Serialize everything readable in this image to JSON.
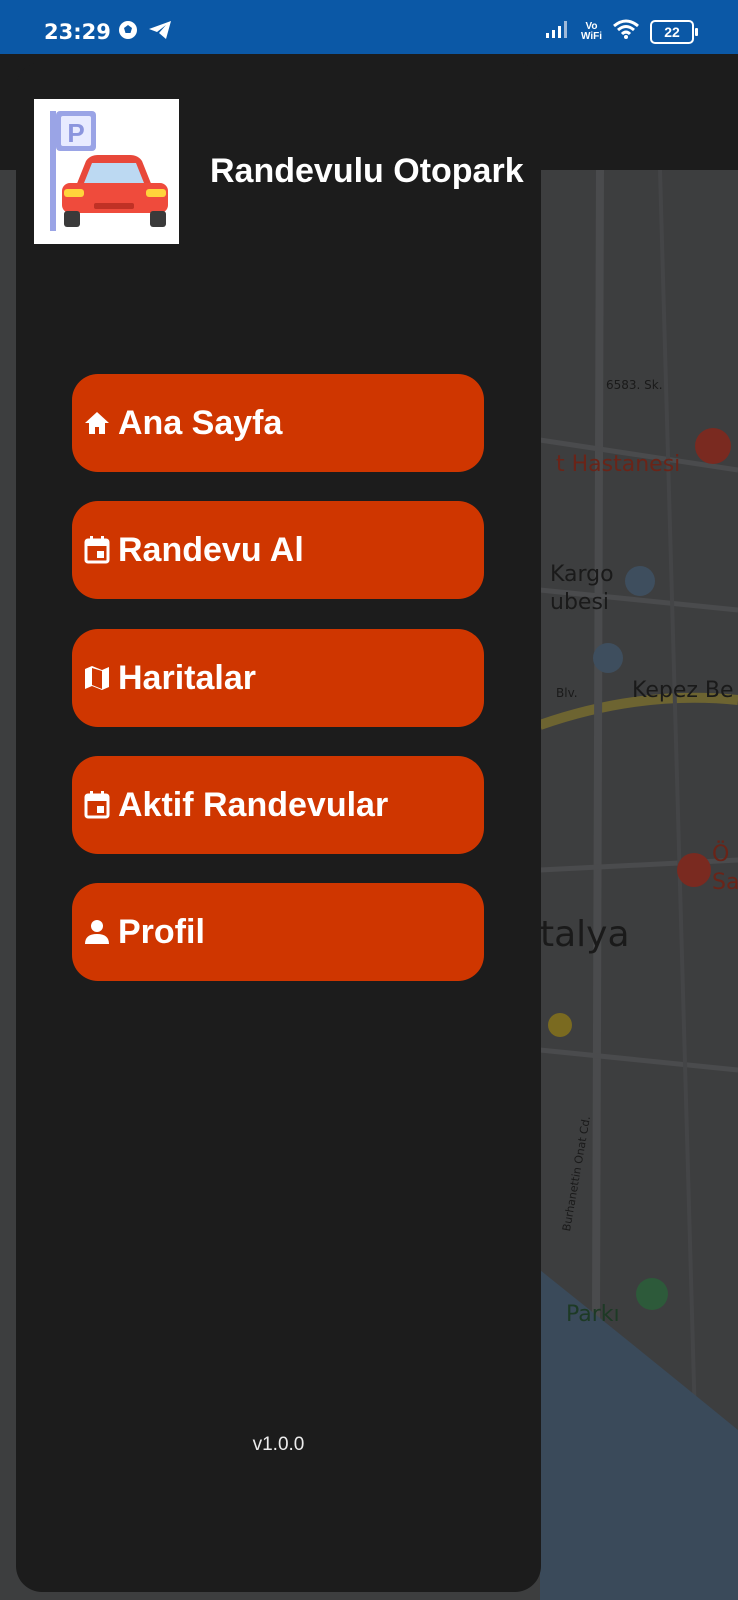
{
  "status": {
    "time": "23:29",
    "network": "Vo WiFi",
    "network_line1": "Vo",
    "network_line2": "WiFi",
    "battery": "22"
  },
  "map": {
    "labels": [
      "6583. Sk.",
      "t Hastanesi",
      "Kargo",
      "ubesi",
      "Blv.",
      "Kepez Be",
      "Ö",
      "Sa",
      "talya",
      "Burhanettin Onat Cd.",
      "Parkı"
    ]
  },
  "drawer": {
    "title": "Randevulu Otopark",
    "items": [
      {
        "label": "Ana Sayfa",
        "icon": "home-icon"
      },
      {
        "label": "Randevu Al",
        "icon": "calendar-icon"
      },
      {
        "label": "Haritalar",
        "icon": "map-icon"
      },
      {
        "label": "Aktif Randevular",
        "icon": "calendar-icon"
      },
      {
        "label": "Profil",
        "icon": "person-icon"
      }
    ],
    "version": "v1.0.0"
  },
  "colors": {
    "status_bar": "#0b58a6",
    "drawer_bg": "#1c1c1c",
    "menu_button": "#cf3600",
    "map_bg": "#3c3c3c"
  }
}
